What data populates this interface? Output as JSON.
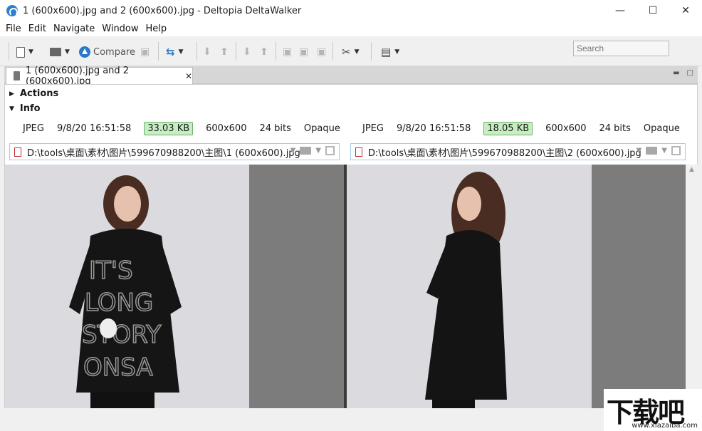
{
  "window": {
    "title": "1 (600x600).jpg and 2 (600x600).jpg - Deltopia DeltaWalker",
    "minimize": "—",
    "maximize": "☐",
    "close": "✕"
  },
  "menu": [
    "File",
    "Edit",
    "Navigate",
    "Window",
    "Help"
  ],
  "toolbar": {
    "compare_label": "Compare",
    "search_placeholder": "Search"
  },
  "tab": {
    "label": "1 (600x600).jpg and 2 (600x600).jpg",
    "close": "✕"
  },
  "sections": {
    "actions": "Actions",
    "info": "Info"
  },
  "left_file": {
    "format": "JPEG",
    "date": "9/8/20 16:51:58",
    "size": "33.03 KB",
    "dimensions": "600x600",
    "bits": "24 bits",
    "transparency": "Opaque",
    "path": "D:\\tools\\桌面\\素材\\图片\\599670988200\\主图\\1 (600x600).jpg"
  },
  "right_file": {
    "format": "JPEG",
    "date": "9/8/20 16:51:58",
    "size": "18.05 KB",
    "dimensions": "600x600",
    "bits": "24 bits",
    "transparency": "Opaque",
    "path": "D:\\tools\\桌面\\素材\\图片\\599670988200\\主图\\2 (600x600).jpg"
  },
  "watermark": {
    "text": "下载吧",
    "url": "www.xiazaiba.com"
  },
  "colors": {
    "accent": "#2d7fd1",
    "size_badge": "#c7eec3",
    "image_gray": "#7c7c7c"
  }
}
